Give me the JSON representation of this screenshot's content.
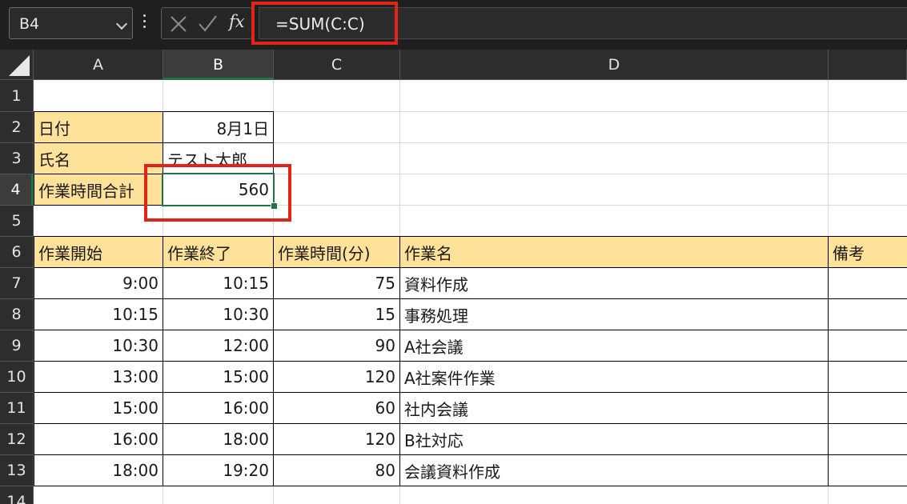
{
  "formula_bar": {
    "name_box": "B4",
    "formula": "=SUM(C:C)",
    "fx_label": "fx",
    "icons": {
      "cancel": "cancel-x-icon",
      "enter": "enter-check-icon",
      "dropdown": "chevron-down-icon",
      "options": "vertical-dots-icon"
    }
  },
  "columns": [
    "A",
    "B",
    "C",
    "D",
    ""
  ],
  "rows": [
    "1",
    "2",
    "3",
    "4",
    "5",
    "6",
    "7",
    "8",
    "9",
    "10",
    "11",
    "12",
    "13",
    "14"
  ],
  "info": {
    "date_label": "日付",
    "date_value": "8月1日",
    "name_label": "氏名",
    "name_value": "テスト太郎",
    "total_label": "作業時間合計",
    "total_value": "560"
  },
  "table": {
    "headers": [
      "作業開始",
      "作業終了",
      "作業時間(分)",
      "作業名",
      "備考"
    ],
    "rows": [
      [
        "9:00",
        "10:15",
        "75",
        "資料作成"
      ],
      [
        "10:15",
        "10:30",
        "15",
        "事務処理"
      ],
      [
        "10:30",
        "12:00",
        "90",
        "A社会議"
      ],
      [
        "13:00",
        "15:00",
        "120",
        "A社案件作業"
      ],
      [
        "15:00",
        "16:00",
        "60",
        "社内会議"
      ],
      [
        "16:00",
        "18:00",
        "120",
        "B社対応"
      ],
      [
        "18:00",
        "19:20",
        "80",
        "会議資料作成"
      ]
    ]
  },
  "colors": {
    "header_fill": "#ffe29a",
    "highlight": "#e2231a",
    "selection": "#217346"
  }
}
